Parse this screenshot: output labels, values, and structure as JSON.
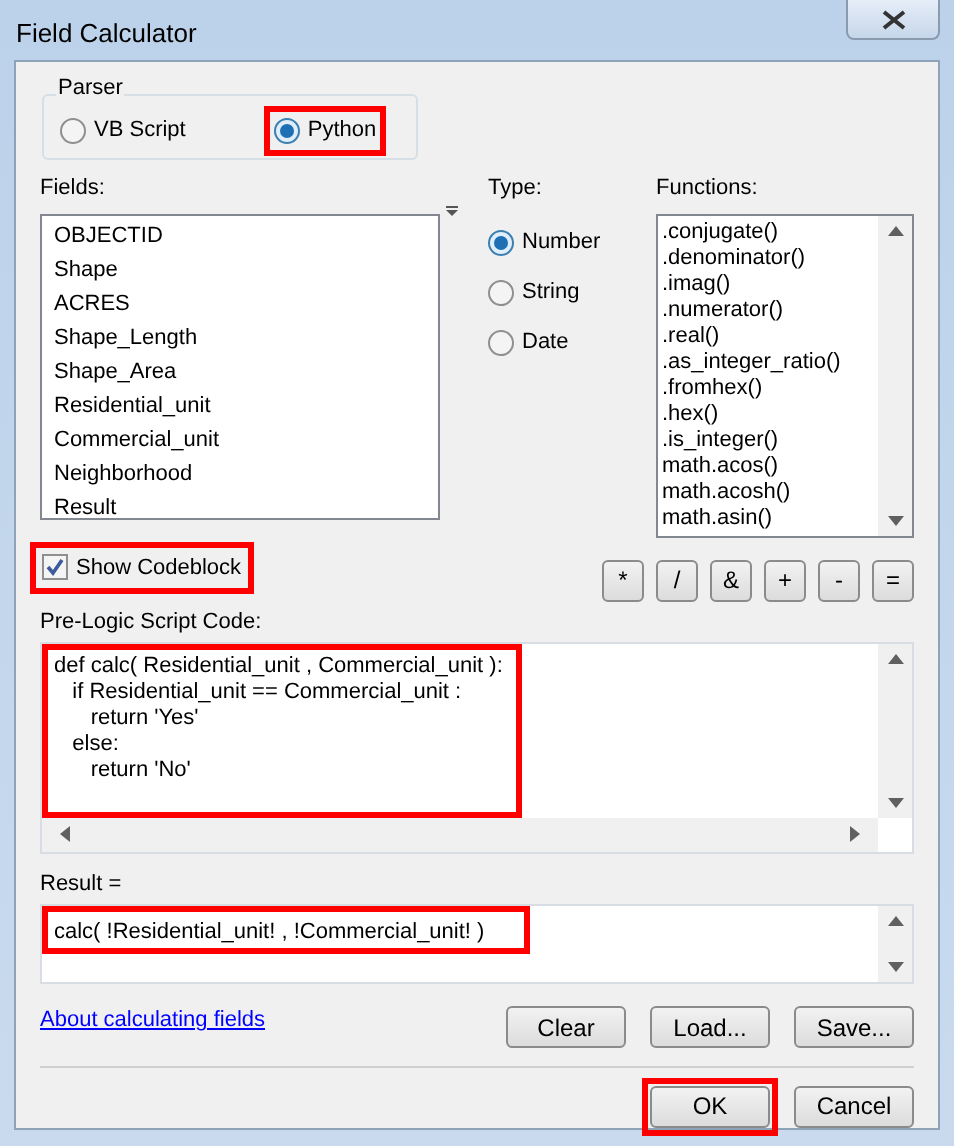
{
  "window": {
    "title": "Field Calculator"
  },
  "parser": {
    "label": "Parser",
    "options": [
      {
        "label": "VB Script",
        "selected": false,
        "highlighted": false
      },
      {
        "label": "Python",
        "selected": true,
        "highlighted": true
      }
    ]
  },
  "fields": {
    "label": "Fields:",
    "items": [
      "OBJECTID",
      "Shape",
      "ACRES",
      "Shape_Length",
      "Shape_Area",
      "Residential_unit",
      "Commercial_unit",
      "Neighborhood",
      "Result"
    ]
  },
  "type": {
    "label": "Type:",
    "options": [
      {
        "label": "Number",
        "selected": true
      },
      {
        "label": "String",
        "selected": false
      },
      {
        "label": "Date",
        "selected": false
      }
    ]
  },
  "functions": {
    "label": "Functions:",
    "items": [
      ".conjugate()",
      ".denominator()",
      ".imag()",
      ".numerator()",
      ".real()",
      ".as_integer_ratio()",
      ".fromhex()",
      ".hex()",
      ".is_integer()",
      "math.acos()",
      "math.acosh()",
      "math.asin()"
    ]
  },
  "show_codeblock": {
    "label": "Show Codeblock",
    "checked": true,
    "highlighted": true
  },
  "operators": [
    "*",
    "/",
    "&",
    "+",
    "-",
    "="
  ],
  "pre_logic": {
    "label": "Pre-Logic Script Code:",
    "highlighted": true,
    "lines": [
      "def calc( Residential_unit , Commercial_unit ):",
      "   if Residential_unit == Commercial_unit :",
      "      return 'Yes'",
      "   else:",
      "      return 'No'"
    ]
  },
  "result": {
    "label": "Result =",
    "value": "calc( !Residential_unit! , !Commercial_unit! )",
    "highlighted": true
  },
  "help_link": "About calculating fields",
  "file_buttons": [
    {
      "label": "Clear",
      "highlighted": false
    },
    {
      "label": "Load...",
      "highlighted": false
    },
    {
      "label": "Save...",
      "highlighted": false
    }
  ],
  "dialog_buttons": [
    {
      "label": "OK",
      "highlighted": true
    },
    {
      "label": "Cancel",
      "highlighted": false
    }
  ]
}
